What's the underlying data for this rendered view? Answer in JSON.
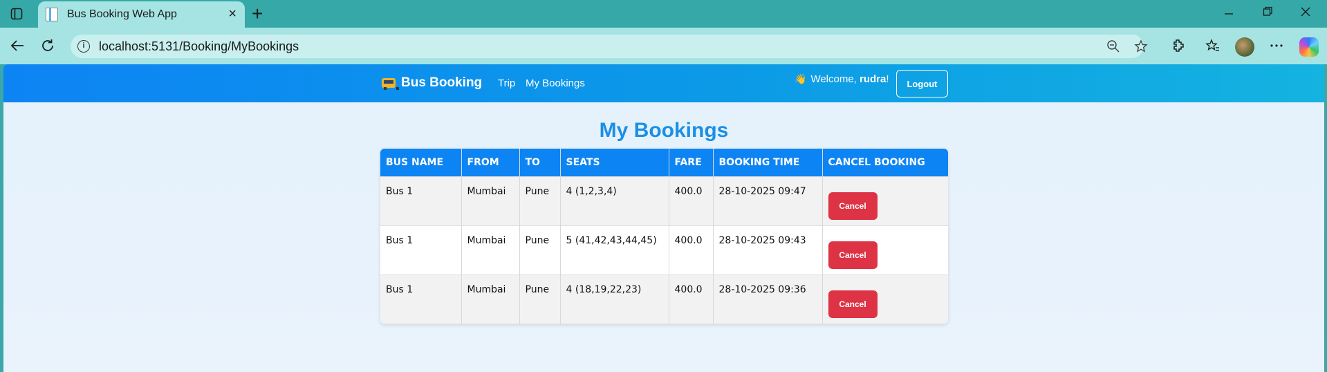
{
  "browser": {
    "tab_title": "Bus Booking Web App",
    "url": "localhost:5131/Booking/MyBookings",
    "new_tab_symbol": "+",
    "close_symbol": "×"
  },
  "navbar": {
    "brand": "Bus Booking",
    "links": [
      "Trip",
      "My Bookings"
    ],
    "welcome_prefix": "Welcome, ",
    "username": "rudra",
    "welcome_suffix": "!",
    "logout_label": "Logout"
  },
  "main": {
    "heading": "My Bookings",
    "columns": [
      "BUS NAME",
      "FROM",
      "TO",
      "SEATS",
      "FARE",
      "BOOKING TIME",
      "CANCEL BOOKING"
    ],
    "rows": [
      {
        "bus": "Bus 1",
        "from": "Mumbai",
        "to": "Pune",
        "seats": "4 (1,2,3,4)",
        "fare": "400.0",
        "time": "28-10-2025 09:47",
        "action": "Cancel"
      },
      {
        "bus": "Bus 1",
        "from": "Mumbai",
        "to": "Pune",
        "seats": "5 (41,42,43,44,45)",
        "fare": "400.0",
        "time": "28-10-2025 09:43",
        "action": "Cancel"
      },
      {
        "bus": "Bus 1",
        "from": "Mumbai",
        "to": "Pune",
        "seats": "4 (18,19,22,23)",
        "fare": "400.0",
        "time": "28-10-2025 09:36",
        "action": "Cancel"
      }
    ]
  },
  "colors": {
    "navbar_start": "#0d84f4",
    "navbar_end": "#14b3e0",
    "heading": "#1a8fe6",
    "cancel": "#dd3344"
  }
}
